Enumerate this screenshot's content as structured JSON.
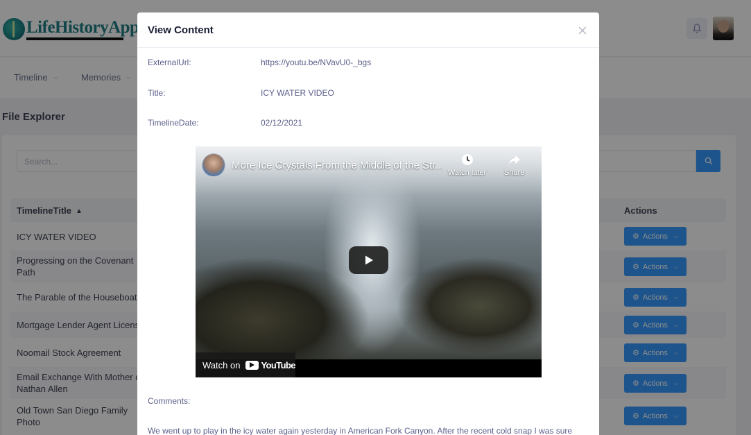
{
  "app": {
    "logo_text": "LifeHistoryApp"
  },
  "nav": {
    "items": [
      {
        "label": "Timeline"
      },
      {
        "label": "Memories"
      }
    ]
  },
  "explorer": {
    "title": "File Explorer",
    "search_placeholder": "Search...",
    "columns": {
      "title": "TimelineTitle",
      "actions": "Actions"
    },
    "rows": [
      {
        "title": "ICY WATER VIDEO",
        "action": "Actions"
      },
      {
        "title": "Progressing on the Covenant Path",
        "action": "Actions"
      },
      {
        "title": "The Parable of the Houseboat",
        "action": "Actions"
      },
      {
        "title": "Mortgage Lender Agent Licens",
        "action": "Actions"
      },
      {
        "title": "Noomail Stock Agreement",
        "action": "Actions"
      },
      {
        "title": "Email Exchange With Mother of Nathan Allen",
        "action": "Actions"
      },
      {
        "title": "Old Town San Diego Family Photo",
        "action": "Actions"
      }
    ]
  },
  "modal": {
    "title": "View Content",
    "fields": {
      "external_url_label": "ExternalUrl:",
      "external_url_value": "https://youtu.be/NVavU0-_bgs",
      "title_label": "Title:",
      "title_value": "ICY WATER VIDEO",
      "date_label": "TimelineDate:",
      "date_value": "02/12/2021"
    },
    "video": {
      "title": "More Ice Crystals From the Middle of the Str...",
      "watch_later": "Watch later",
      "share": "Share",
      "watch_on": "Watch on",
      "youtube": "YouTube"
    },
    "comments_label": "Comments:",
    "comments_text": "We went up to play in the icy water again yesterday in American Fork Canyon. After the recent cold snap I was sure"
  },
  "colors": {
    "primary": "#3699ff",
    "logo": "#1f7f86"
  }
}
